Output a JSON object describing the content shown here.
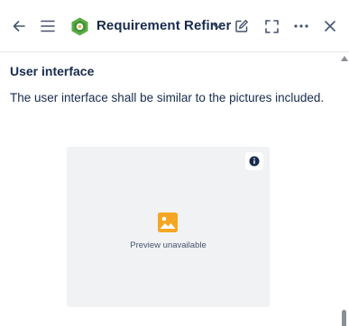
{
  "header": {
    "app_title": "Requirement Refiner",
    "icons": {
      "back": "arrow-left-icon",
      "menu": "hamburger-menu-icon",
      "logo": "app-logo-icon",
      "dropdown": "chevron-down-icon",
      "edit": "edit-icon",
      "fullscreen": "fullscreen-icon",
      "more": "more-icon",
      "close": "close-icon"
    }
  },
  "content": {
    "section_title": "User interface",
    "body_text": "The user interface shall be similar to the pictures included.",
    "preview": {
      "label": "Preview unavailable",
      "icon": "image-icon",
      "info_icon": "info-icon"
    }
  },
  "colors": {
    "text": "#172b4d",
    "logo_green": "#5aac44",
    "image_icon_orange": "#f5a623",
    "preview_bg": "#f1f2f4"
  }
}
